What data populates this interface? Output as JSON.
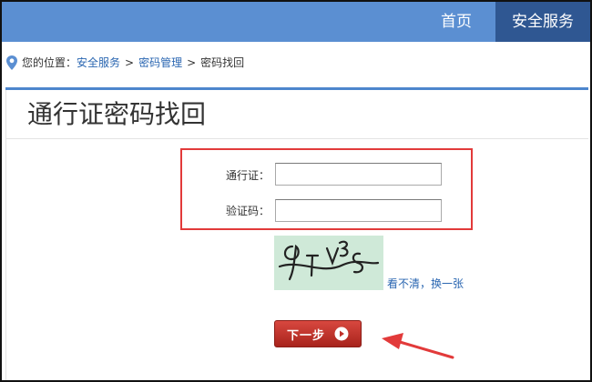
{
  "nav": {
    "home_label": "首页",
    "security_label": "安全服务"
  },
  "breadcrumb": {
    "prefix": "您的位置：",
    "items": [
      "安全服务",
      "密码管理",
      "密码找回"
    ],
    "separator": ">"
  },
  "page": {
    "title": "通行证密码找回"
  },
  "form": {
    "account_label": "通行证：",
    "account_value": "",
    "code_label": "验证码：",
    "code_value": "",
    "refresh_label": "看不清，换一张"
  },
  "actions": {
    "next_label": "下一步"
  },
  "colors": {
    "nav_bg": "#5b8fd2",
    "nav_active": "#2f5792",
    "highlight_box": "#e23a3a",
    "button": "#c0302a",
    "link": "#2a66b1"
  }
}
